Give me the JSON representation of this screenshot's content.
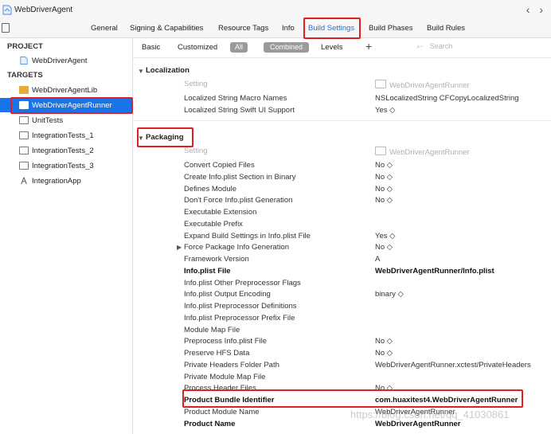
{
  "window": {
    "title": "WebDriverAgent",
    "nav_arrows": "‹ ›"
  },
  "tabs": [
    {
      "label": "General"
    },
    {
      "label": "Signing & Capabilities"
    },
    {
      "label": "Resource Tags"
    },
    {
      "label": "Info"
    },
    {
      "label": "Build Settings",
      "active": true
    },
    {
      "label": "Build Phases"
    },
    {
      "label": "Build Rules"
    }
  ],
  "sidebar": {
    "project_header": "PROJECT",
    "project_item": "WebDriverAgent",
    "targets_header": "TARGETS",
    "targets": [
      {
        "label": "WebDriverAgentLib",
        "icon": "library-icon"
      },
      {
        "label": "WebDriverAgentRunner",
        "icon": "folder-icon",
        "selected": true
      },
      {
        "label": "UnitTests",
        "icon": "folder-icon"
      },
      {
        "label": "IntegrationTests_1",
        "icon": "folder-icon"
      },
      {
        "label": "IntegrationTests_2",
        "icon": "folder-icon"
      },
      {
        "label": "IntegrationTests_3",
        "icon": "folder-icon"
      },
      {
        "label": "IntegrationApp",
        "icon": "app-icon"
      }
    ]
  },
  "filter": {
    "basic": "Basic",
    "customized": "Customized",
    "all": "All",
    "combined": "Combined",
    "levels": "Levels",
    "plus": "+",
    "search_placeholder": "Search"
  },
  "localization": {
    "title": "Localization",
    "header_name": "Setting",
    "header_value": "WebDriverAgentRunner",
    "rows": [
      {
        "name": "Localized String Macro Names",
        "value": "NSLocalizedString CFCopyLocalizedString"
      },
      {
        "name": "Localized String Swift UI Support",
        "value": "Yes ◇"
      }
    ]
  },
  "packaging": {
    "title": "Packaging",
    "header_name": "Setting",
    "header_value": "WebDriverAgentRunner",
    "rows": [
      {
        "name": "Convert Copied Files",
        "value": "No ◇"
      },
      {
        "name": "Create Info.plist Section in Binary",
        "value": "No ◇"
      },
      {
        "name": "Defines Module",
        "value": "No ◇"
      },
      {
        "name": "Don't Force Info.plist Generation",
        "value": "No ◇"
      },
      {
        "name": "Executable Extension",
        "value": ""
      },
      {
        "name": "Executable Prefix",
        "value": ""
      },
      {
        "name": "Expand Build Settings in Info.plist File",
        "value": "Yes ◇"
      },
      {
        "name": "Force Package Info Generation",
        "value": "No ◇"
      },
      {
        "name": "Framework Version",
        "value": "A"
      },
      {
        "name": "Info.plist File",
        "value": "WebDriverAgentRunner/Info.plist"
      },
      {
        "name": "Info.plist Other Preprocessor Flags",
        "value": ""
      },
      {
        "name": "Info.plist Output Encoding",
        "value": "binary ◇"
      },
      {
        "name": "Info.plist Preprocessor Definitions",
        "value": ""
      },
      {
        "name": "Info.plist Preprocessor Prefix File",
        "value": ""
      },
      {
        "name": "Module Map File",
        "value": ""
      },
      {
        "name": "Preprocess Info.plist File",
        "value": "No ◇"
      },
      {
        "name": "Preserve HFS Data",
        "value": "No ◇"
      },
      {
        "name": "Private Headers Folder Path",
        "value": "WebDriverAgentRunner.xctest/PrivateHeaders"
      },
      {
        "name": "Private Module Map File",
        "value": ""
      },
      {
        "name": "Process Header Files",
        "value": "No ◇"
      },
      {
        "name": "Product Bundle Identifier",
        "value": "com.huaxitest4.WebDriverAgentRunner"
      },
      {
        "name": "Product Module Name",
        "value": "WebDriverAgentRunner"
      },
      {
        "name": "Product Name",
        "value": "WebDriverAgentRunner"
      }
    ]
  },
  "watermark": "https://blog.csdn.net/qq_41030861",
  "colors": {
    "accent": "#1a73e8",
    "highlight": "#e02020"
  }
}
